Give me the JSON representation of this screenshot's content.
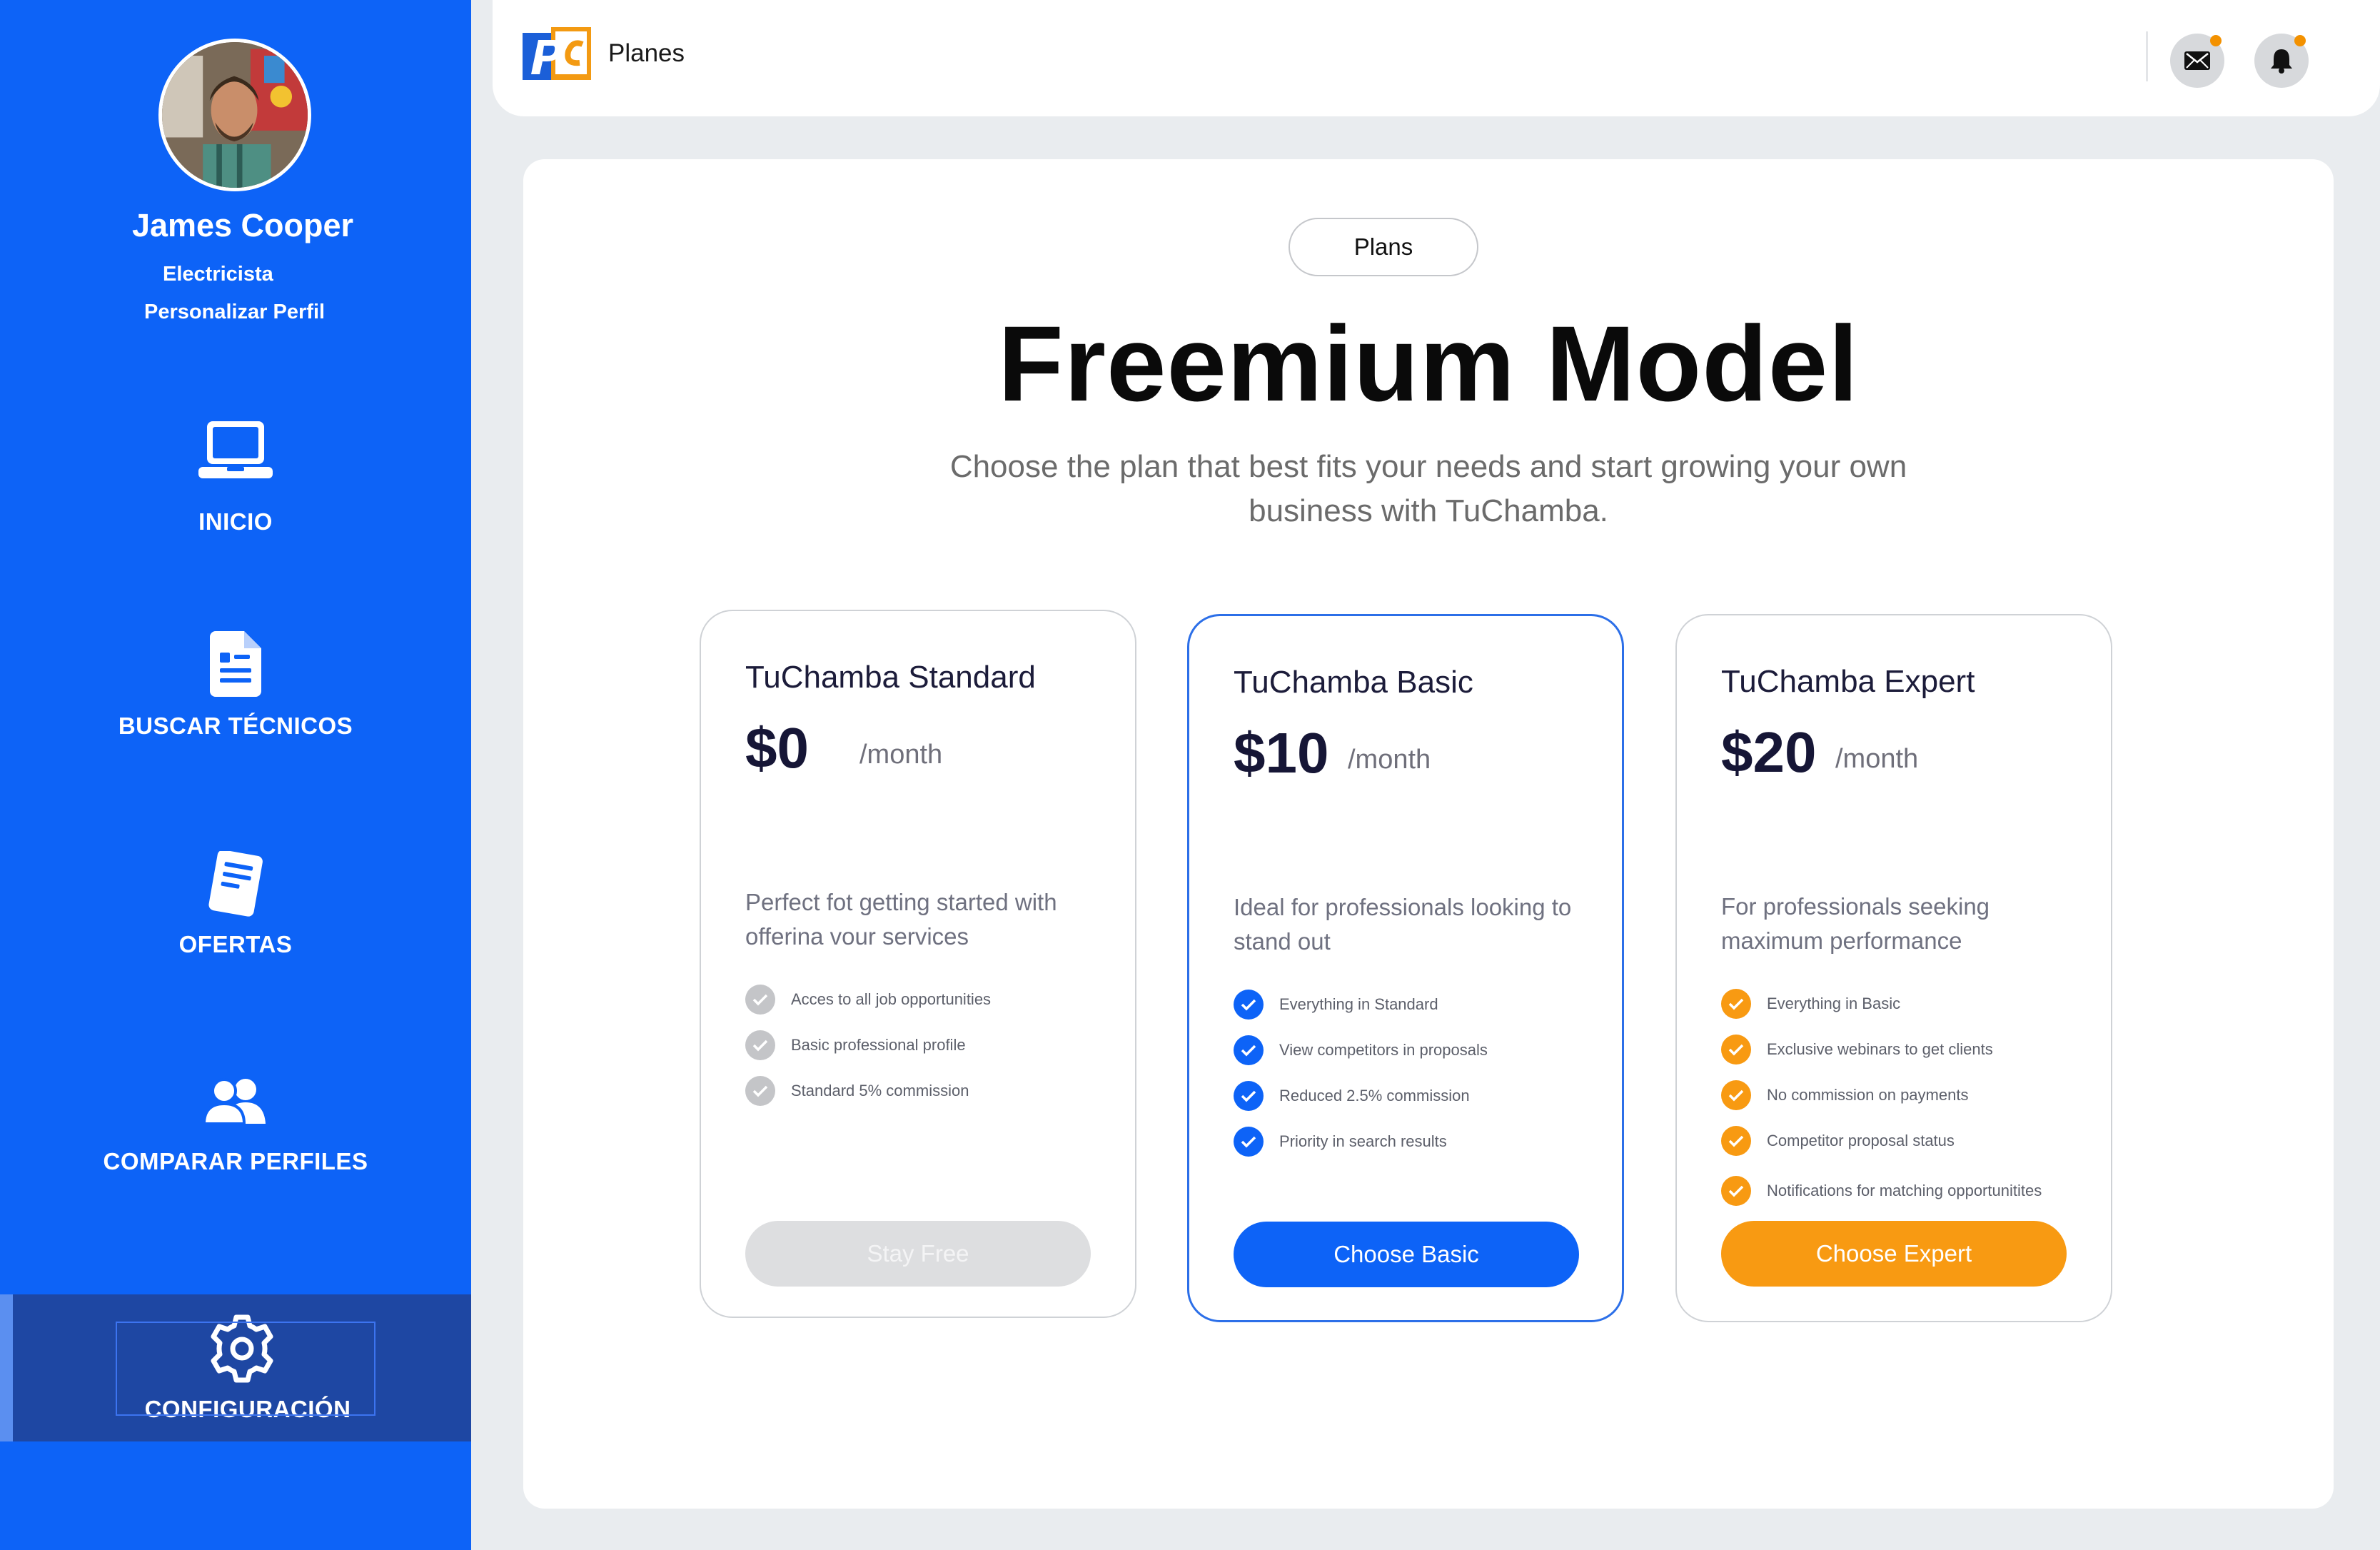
{
  "sidebar": {
    "user": {
      "name": "James Cooper",
      "role": "Electricista",
      "customize_link": "Personalizar Perfil"
    },
    "items": [
      {
        "label": "INICIO",
        "icon": "laptop-icon"
      },
      {
        "label": "BUSCAR TÉCNICOS",
        "icon": "document-icon"
      },
      {
        "label": "OFERTAS",
        "icon": "paper-icon"
      },
      {
        "label": "COMPARAR PERFILES",
        "icon": "users-icon"
      },
      {
        "label": "CONFIGURACIÓN",
        "icon": "gear-icon",
        "active": true
      }
    ]
  },
  "header": {
    "title": "Planes",
    "icons": [
      "mail-icon",
      "bell-icon"
    ],
    "notification_dot_color": "#f39100"
  },
  "main": {
    "pill": "Plans",
    "title": "Freemium Model",
    "subtitle": "Choose the plan that best fits your needs and start growing your own business with TuChamba."
  },
  "plans": [
    {
      "name": "TuChamba Standard",
      "price": "$0",
      "period": "/month",
      "description": "Perfect fot getting started with offerina vour services",
      "features": [
        "Acces to all job opportunities",
        "Basic professional profile",
        "Standard 5% commission"
      ],
      "button": "Stay Free",
      "accent": "#c4c5c8"
    },
    {
      "name": "TuChamba Basic",
      "price": "$10",
      "period": "/month",
      "description": "Ideal for professionals looking to stand out",
      "features": [
        "Everything in Standard",
        "View competitors in proposals",
        "Reduced 2.5% commission",
        "Priority in search results"
      ],
      "button": "Choose Basic",
      "accent": "#0d63f7"
    },
    {
      "name": "TuChamba Expert",
      "price": "$20",
      "period": "/month",
      "description": "For professionals seeking maximum performance",
      "features": [
        "Everything in Basic",
        "Exclusive webinars to get clients",
        "No commission on payments",
        "Competitor proposal status",
        "Notifications for matching opportunitites"
      ],
      "button": "Choose Expert",
      "accent": "#f89a12"
    }
  ],
  "colors": {
    "sidebar_bg": "#0d63f7",
    "sidebar_active": "#1e47a3",
    "page_bg": "#e9ecef"
  }
}
